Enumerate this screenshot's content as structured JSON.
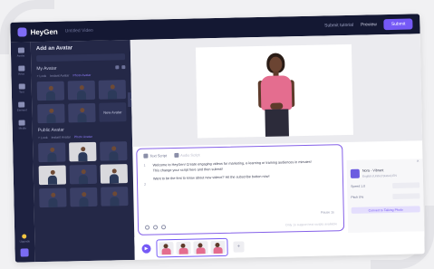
{
  "app": {
    "brand": "HeyGen",
    "project_name": "Untitled Video",
    "top_links": [
      "Submit tutorial"
    ],
    "preview_label": "Preview",
    "submit_label": "Submit"
  },
  "rail": {
    "items": [
      "Avatar",
      "Voice",
      "Text",
      "Element",
      "Media"
    ],
    "bottom": [
      "Upgrade"
    ]
  },
  "avatar_panel": {
    "title": "Add an Avatar",
    "my_avatars_title": "My Avatar",
    "my_filters": [
      "+ Look",
      "Instant Avatar",
      "Photo Avatar"
    ],
    "add_label": "New Avatar",
    "public_title": "Public Avatar",
    "public_filters": [
      "+ Look",
      "Instant Avatar",
      "Photo Avatar"
    ]
  },
  "script": {
    "tabs": [
      "Text Script",
      "Audio Script"
    ],
    "lines": [
      "Welcome to HeyGen! Create engaging videos for marketing, e-learning or training audiences in minutes!",
      "This change your script here and then submit!",
      "Want to be the first to know about new videos? Hit the subscribe button now!"
    ],
    "numbers": [
      "1",
      "2"
    ],
    "pause_label": "Pause 1s",
    "footer_note": "Only 1x support text scripts available"
  },
  "props": {
    "avatar_name": "Nora - Vibrant",
    "avatar_sub": "English (United States) EN",
    "rows": [
      {
        "label": "Speed 1.0",
        "value": ""
      },
      {
        "label": "Pitch 0%",
        "value": ""
      }
    ],
    "cta": "Convert to Talking Photo"
  },
  "timeline": {
    "scene_count": 4
  }
}
